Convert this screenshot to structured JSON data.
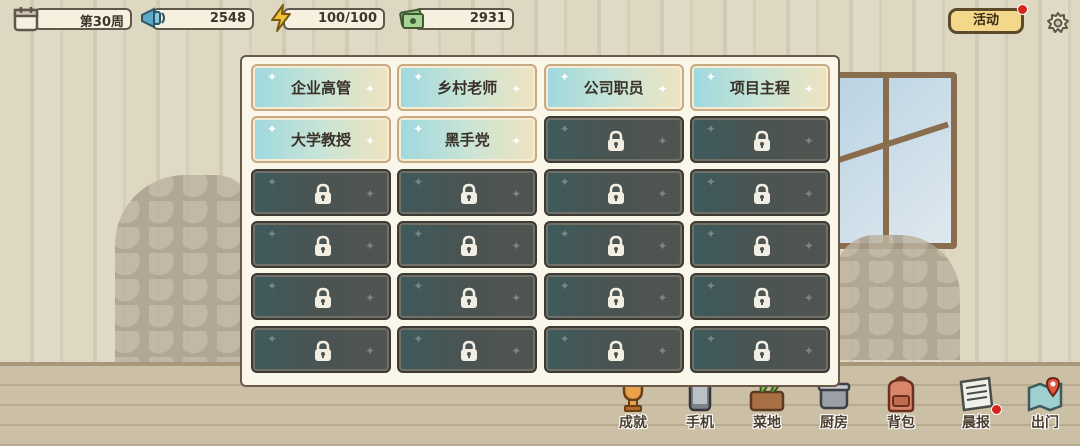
{
  "status_bar": {
    "week_label": "第30周",
    "fame_value": "2548",
    "energy_value": "100/100",
    "money_value": "2931",
    "events_button": "活动"
  },
  "jobs": [
    {
      "name": "企业高管",
      "locked": false
    },
    {
      "name": "乡村老师",
      "locked": false
    },
    {
      "name": "公司职员",
      "locked": false
    },
    {
      "name": "项目主程",
      "locked": false
    },
    {
      "name": "大学教授",
      "locked": false
    },
    {
      "name": "黑手党",
      "locked": false
    },
    {
      "name": "",
      "locked": true
    },
    {
      "name": "",
      "locked": true
    },
    {
      "name": "",
      "locked": true
    },
    {
      "name": "",
      "locked": true
    },
    {
      "name": "",
      "locked": true
    },
    {
      "name": "",
      "locked": true
    },
    {
      "name": "",
      "locked": true
    },
    {
      "name": "",
      "locked": true
    },
    {
      "name": "",
      "locked": true
    },
    {
      "name": "",
      "locked": true
    },
    {
      "name": "",
      "locked": true
    },
    {
      "name": "",
      "locked": true
    },
    {
      "name": "",
      "locked": true
    },
    {
      "name": "",
      "locked": true
    },
    {
      "name": "",
      "locked": true
    },
    {
      "name": "",
      "locked": true
    },
    {
      "name": "",
      "locked": true
    },
    {
      "name": "",
      "locked": true
    }
  ],
  "bottom_nav": [
    {
      "label": "成就",
      "icon": "trophy-icon"
    },
    {
      "label": "手机",
      "icon": "phone-icon"
    },
    {
      "label": "菜地",
      "icon": "garden-icon"
    },
    {
      "label": "厨房",
      "icon": "cooking-pot-icon"
    },
    {
      "label": "背包",
      "icon": "backpack-icon"
    },
    {
      "label": "晨报",
      "icon": "newspaper-icon"
    },
    {
      "label": "出门",
      "icon": "map-pin-icon"
    }
  ],
  "colors": {
    "notification_dot": "#d4261c",
    "unlocked_card": "#9ed8df",
    "locked_card": "#3e5a5c",
    "events_button": "#f3d78a"
  }
}
